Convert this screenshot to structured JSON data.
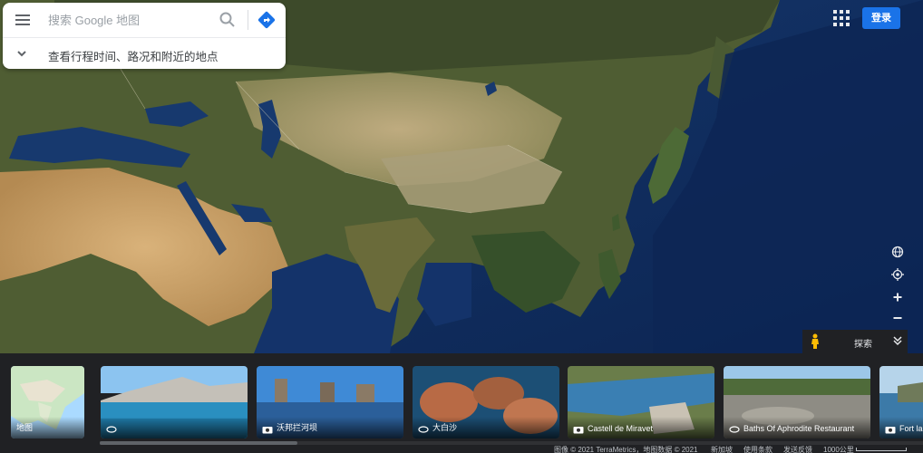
{
  "search": {
    "placeholder": "搜索 Google 地图",
    "trip_hint": "查看行程时间、路况和附近的地点"
  },
  "header": {
    "signin_label": "登录"
  },
  "explore": {
    "label": "探索"
  },
  "cards": [
    {
      "label": "地图",
      "icon": "none"
    },
    {
      "label": "",
      "icon": "360-icon"
    },
    {
      "label": "沃邦拦河坝",
      "icon": "camera-icon"
    },
    {
      "label": "大白沙",
      "icon": "360-icon"
    },
    {
      "label": "Castell de Miravet",
      "icon": "camera-icon"
    },
    {
      "label": "Baths Of Aphrodite Restaurant",
      "icon": "360-icon"
    },
    {
      "label": "Fort la",
      "icon": "camera-icon"
    }
  ],
  "footer": {
    "imagery": "图像 © 2021 TerraMetrics，地图数据 © 2021",
    "region": "新加坡",
    "terms": "使用条款",
    "feedback": "发送反馈",
    "scale": "1000公里"
  },
  "colors": {
    "ocean": "#0f2d5c",
    "land_green": "#4a5a2e",
    "desert": "#c9a26a",
    "accent_blue": "#1a73e8",
    "panel": "#202124"
  }
}
